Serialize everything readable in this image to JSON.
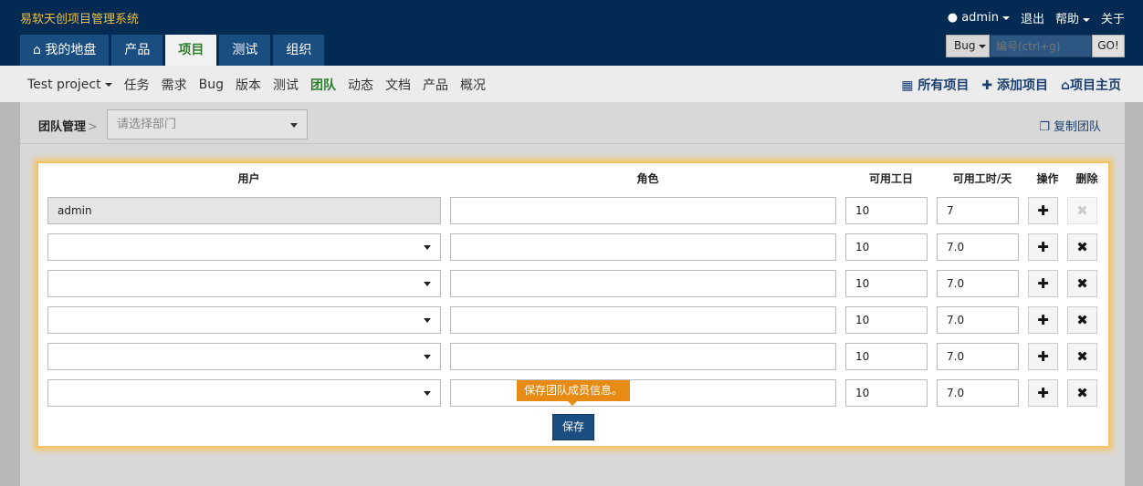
{
  "header": {
    "app_title": "易软天创项目管理系统",
    "user": "admin",
    "logout": "退出",
    "help": "帮助",
    "about": "关于",
    "tabs": [
      {
        "label": "我的地盘",
        "icon": "home-icon"
      },
      {
        "label": "产品"
      },
      {
        "label": "项目"
      },
      {
        "label": "测试"
      },
      {
        "label": "组织"
      }
    ],
    "active_tab": "项目",
    "search": {
      "type": "Bug",
      "placeholder": "编号(ctrl+g)",
      "go": "GO!"
    }
  },
  "subnav": {
    "project": "Test project",
    "items": [
      "任务",
      "需求",
      "Bug",
      "版本",
      "测试",
      "团队",
      "动态",
      "文档",
      "产品",
      "概况"
    ],
    "active": "团队",
    "right": [
      {
        "label": "所有项目",
        "icon": "grid-icon"
      },
      {
        "label": "添加项目",
        "icon": "plus-icon"
      },
      {
        "label": "项目主页",
        "icon": "home-icon"
      }
    ]
  },
  "panel": {
    "title": "团队管理",
    "dept_placeholder": "请选择部门",
    "copy_team": "复制团队"
  },
  "team": {
    "columns": [
      "用户",
      "角色",
      "可用工日",
      "可用工时/天",
      "操作",
      "删除"
    ],
    "rows": [
      {
        "user": "admin",
        "role": "",
        "days": "10",
        "hours": "7"
      },
      {
        "user": "",
        "role": "",
        "days": "10",
        "hours": "7.0"
      },
      {
        "user": "",
        "role": "",
        "days": "10",
        "hours": "7.0"
      },
      {
        "user": "",
        "role": "",
        "days": "10",
        "hours": "7.0"
      },
      {
        "user": "",
        "role": "",
        "days": "10",
        "hours": "7.0"
      },
      {
        "user": "",
        "role": "",
        "days": "10",
        "hours": "7.0"
      }
    ],
    "save": "保存",
    "tooltip": "保存团队成员信息。"
  }
}
